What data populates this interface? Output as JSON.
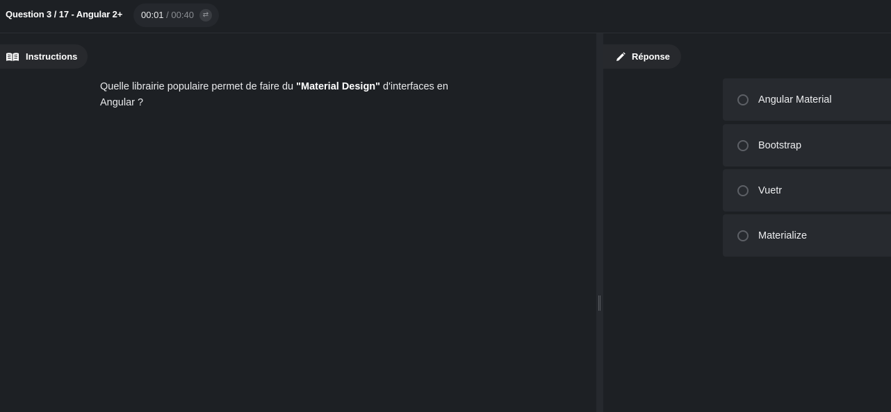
{
  "header": {
    "question_title": "Question 3 / 17 - Angular 2+",
    "timer": {
      "elapsed": "00:01",
      "separator": " / ",
      "total": "00:40",
      "swap_icon": "swap-arrows-icon"
    }
  },
  "instructions": {
    "tab_label": "Instructions",
    "icon": "book-icon",
    "question": {
      "before": "Quelle librairie populaire permet de faire du ",
      "bold": "\"Material Design\"",
      "after": " d'interfaces en Angular ?"
    }
  },
  "response": {
    "tab_label": "Réponse",
    "icon": "pencil-icon",
    "options": [
      {
        "label": "Angular Material",
        "selected": false
      },
      {
        "label": "Bootstrap",
        "selected": false
      },
      {
        "label": "Vuetr",
        "selected": false
      },
      {
        "label": "Materialize",
        "selected": false
      }
    ]
  },
  "colors": {
    "background": "#1d2024",
    "panel": "#272a2f",
    "text": "#e8e9eb",
    "muted": "#8a8d92"
  }
}
